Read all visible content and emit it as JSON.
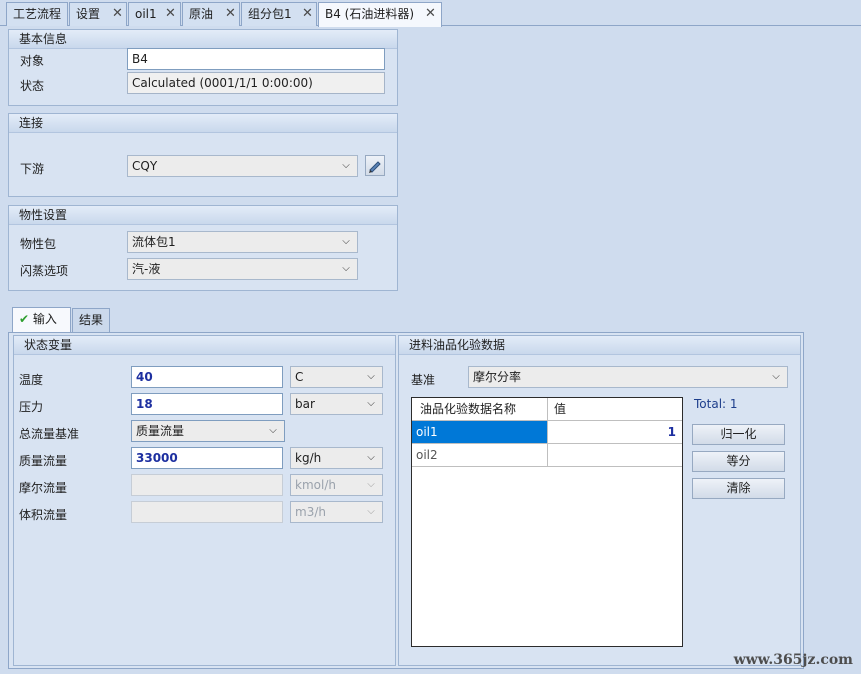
{
  "doc_tabs": [
    {
      "label": "工艺流程",
      "closable": false,
      "active": false
    },
    {
      "label": "设置",
      "closable": true,
      "active": false
    },
    {
      "label": "oil1",
      "closable": true,
      "active": false
    },
    {
      "label": "原油",
      "closable": true,
      "active": false
    },
    {
      "label": "组分包1",
      "closable": true,
      "active": false
    },
    {
      "label": "B4 (石油进料器)",
      "closable": true,
      "active": true
    }
  ],
  "close_glyph": "✕",
  "basic": {
    "title": "基本信息",
    "object_label": "对象",
    "object_value": "B4",
    "status_label": "状态",
    "status_value": "Calculated (0001/1/1 0:00:00)"
  },
  "connection": {
    "title": "连接",
    "downstream_label": "下游",
    "downstream_value": "CQY"
  },
  "property": {
    "title": "物性设置",
    "package_label": "物性包",
    "package_value": "流体包1",
    "flash_label": "闪蒸选项",
    "flash_value": "汽-液"
  },
  "lower_tabs": [
    {
      "label": "输入",
      "active": true,
      "icon": "check-icon"
    },
    {
      "label": "结果",
      "active": false
    }
  ],
  "state": {
    "title": "状态变量",
    "rows": [
      {
        "label": "温度",
        "value": "40",
        "unit": "C",
        "enabled": true
      },
      {
        "label": "压力",
        "value": "18",
        "unit": "bar",
        "enabled": true
      },
      {
        "label": "总流量基准",
        "value": "质量流量",
        "unit": "",
        "enabled": true
      },
      {
        "label": "质量流量",
        "value": "33000",
        "unit": "kg/h",
        "enabled": true
      },
      {
        "label": "摩尔流量",
        "value": "",
        "unit": "kmol/h",
        "enabled": false
      },
      {
        "label": "体积流量",
        "value": "",
        "unit": "m3/h",
        "enabled": false
      }
    ]
  },
  "assay": {
    "title": "进料油品化验数据",
    "basis_label": "基准",
    "basis_value": "摩尔分率",
    "total_text": "Total: 1",
    "columns": [
      "油品化验数据名称",
      "值"
    ],
    "rows": [
      {
        "name": "oil1",
        "value": "1",
        "selected": true
      },
      {
        "name": "oil2",
        "value": "",
        "selected": false
      }
    ],
    "buttons": {
      "normalize": "归一化",
      "equal": "等分",
      "clear": "清除"
    }
  },
  "colors": {
    "accent": "#0078d7",
    "value_text": "#1d2fa0",
    "panel_bg": "#cfdcee"
  },
  "watermark": "www.365jz.com"
}
